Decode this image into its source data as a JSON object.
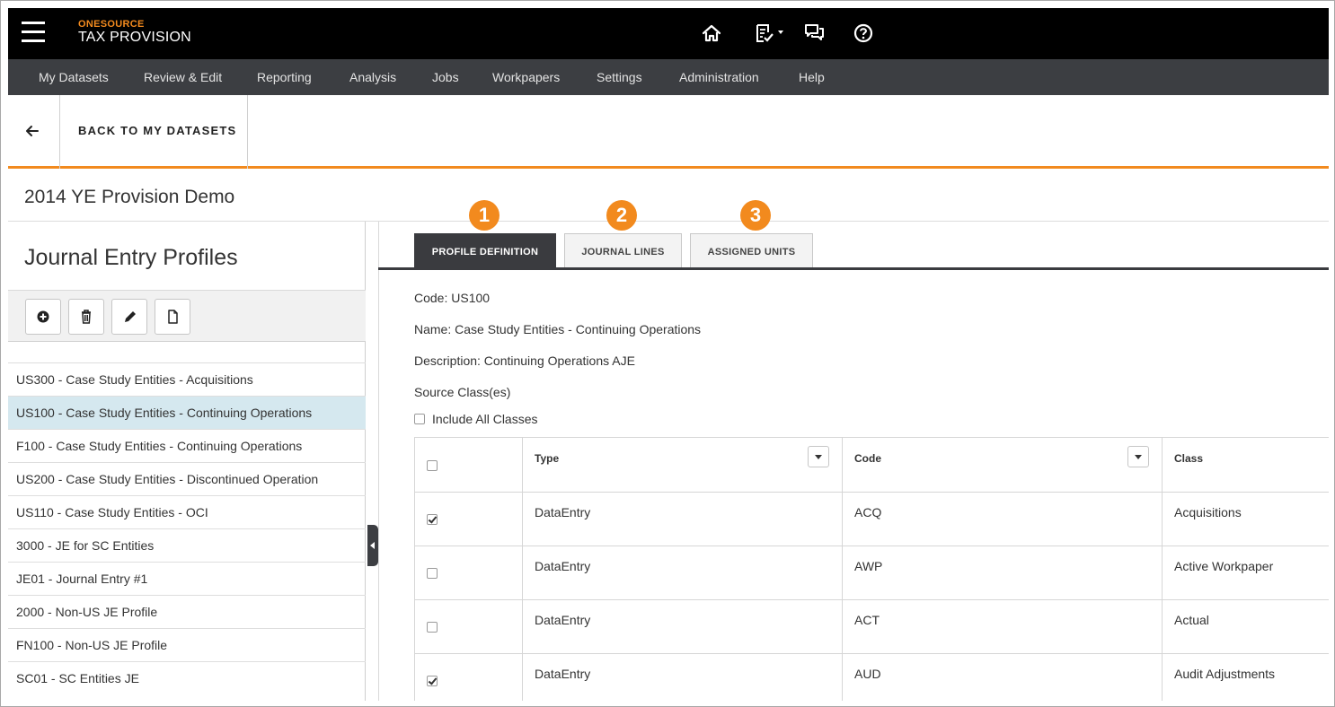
{
  "app": {
    "brand_top": "ONESOURCE",
    "brand_bottom": "TAX PROVISION"
  },
  "top_icons": [
    "home-icon",
    "task-list-icon",
    "chat-icon",
    "help-icon"
  ],
  "menu": [
    "My Datasets",
    "Review & Edit",
    "Reporting",
    "Analysis",
    "Jobs",
    "Workpapers",
    "Settings",
    "Administration",
    "Help"
  ],
  "back_label": "BACK TO MY DATASETS",
  "dataset_title": "2014 YE Provision Demo",
  "left_panel": {
    "title": "Journal Entry Profiles",
    "toolbar": [
      "add-icon",
      "delete-icon",
      "edit-icon",
      "document-icon"
    ],
    "items": [
      "US300 - Case Study Entities - Acquisitions",
      "US100 - Case Study Entities - Continuing Operations",
      "F100 - Case Study Entities - Continuing Operations",
      "US200 - Case Study Entities - Discontinued Operation",
      "US110 - Case Study Entities - OCI",
      "3000 - JE for SC Entities",
      "JE01 - Journal Entry #1",
      "2000 - Non-US JE Profile",
      "FN100 - Non-US JE Profile",
      "SC01 - SC Entities JE"
    ],
    "selected_index": 1
  },
  "tabs": {
    "badges": [
      "1",
      "2",
      "3"
    ],
    "labels": [
      "PROFILE DEFINITION",
      "JOURNAL LINES",
      "ASSIGNED UNITS"
    ],
    "active_index": 0
  },
  "profile": {
    "code": "Code: US100",
    "name": "Name: Case Study Entities - Continuing Operations",
    "description": "Description: Continuing Operations AJE",
    "source_classes_label": "Source Class(es)",
    "include_all_label": "Include All Classes",
    "include_all_checked": false
  },
  "grid": {
    "headers": [
      "Type",
      "Code",
      "Class"
    ],
    "header_checked": false,
    "rows": [
      {
        "checked": true,
        "type": "DataEntry",
        "code": "ACQ",
        "class": "Acquisitions"
      },
      {
        "checked": false,
        "type": "DataEntry",
        "code": "AWP",
        "class": "Active Workpaper"
      },
      {
        "checked": false,
        "type": "DataEntry",
        "code": "ACT",
        "class": "Actual"
      },
      {
        "checked": true,
        "type": "DataEntry",
        "code": "AUD",
        "class": "Audit Adjustments"
      }
    ]
  },
  "colors": {
    "accent": "#f28a1e",
    "topbar": "#000000",
    "menubar": "#3c3e42",
    "selected_row": "#d5e8ef"
  }
}
